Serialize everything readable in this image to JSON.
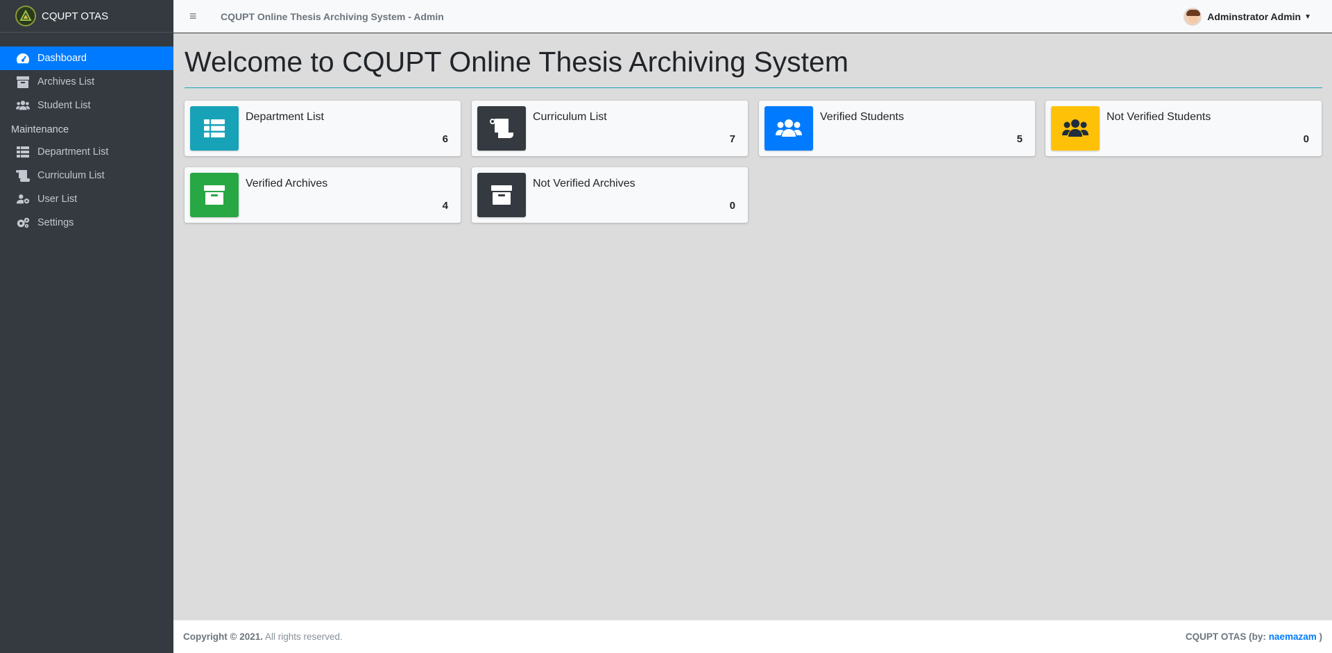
{
  "brand": {
    "name": "CQUPT OTAS"
  },
  "sidebar": {
    "items": [
      {
        "label": "Dashboard",
        "icon": "tachometer-icon",
        "active": true
      },
      {
        "label": "Archives List",
        "icon": "archive-icon"
      },
      {
        "label": "Student List",
        "icon": "users-icon"
      }
    ],
    "maintenance_header": "Maintenance",
    "maintenance_items": [
      {
        "label": "Department List",
        "icon": "th-list-icon"
      },
      {
        "label": "Curriculum List",
        "icon": "scroll-icon"
      },
      {
        "label": "User List",
        "icon": "users-cog-icon"
      },
      {
        "label": "Settings",
        "icon": "cogs-icon"
      }
    ]
  },
  "header": {
    "menu_icon": "hamburger-icon",
    "title": "CQUPT Online Thesis Archiving System - Admin",
    "user_name": "Adminstrator Admin"
  },
  "main": {
    "title": "Welcome to CQUPT Online Thesis Archiving System",
    "boxes": [
      {
        "label": "Department List",
        "value": "6",
        "icon": "th-list-icon",
        "color": "#17a2b8"
      },
      {
        "label": "Curriculum List",
        "value": "7",
        "icon": "scroll-icon",
        "color": "#343a40"
      },
      {
        "label": "Verified Students",
        "value": "5",
        "icon": "users-icon",
        "color": "#007bff"
      },
      {
        "label": "Not Verified Students",
        "value": "0",
        "icon": "users-icon",
        "color": "#ffc107"
      },
      {
        "label": "Verified Archives",
        "value": "4",
        "icon": "archive-icon",
        "color": "#28a745"
      },
      {
        "label": "Not Verified Archives",
        "value": "0",
        "icon": "archive-icon",
        "color": "#343a40"
      }
    ]
  },
  "footer": {
    "copyright": "Copyright © 2021.",
    "rights": "All rights reserved.",
    "credit_prefix": "CQUPT OTAS (by:",
    "credit_author": "naemazam",
    "credit_suffix": ")"
  },
  "colors": {
    "sidebar_bg": "#343a40",
    "active": "#007bff",
    "info": "#17a2b8",
    "success": "#28a745",
    "warning": "#ffc107",
    "dark": "#343a40"
  }
}
